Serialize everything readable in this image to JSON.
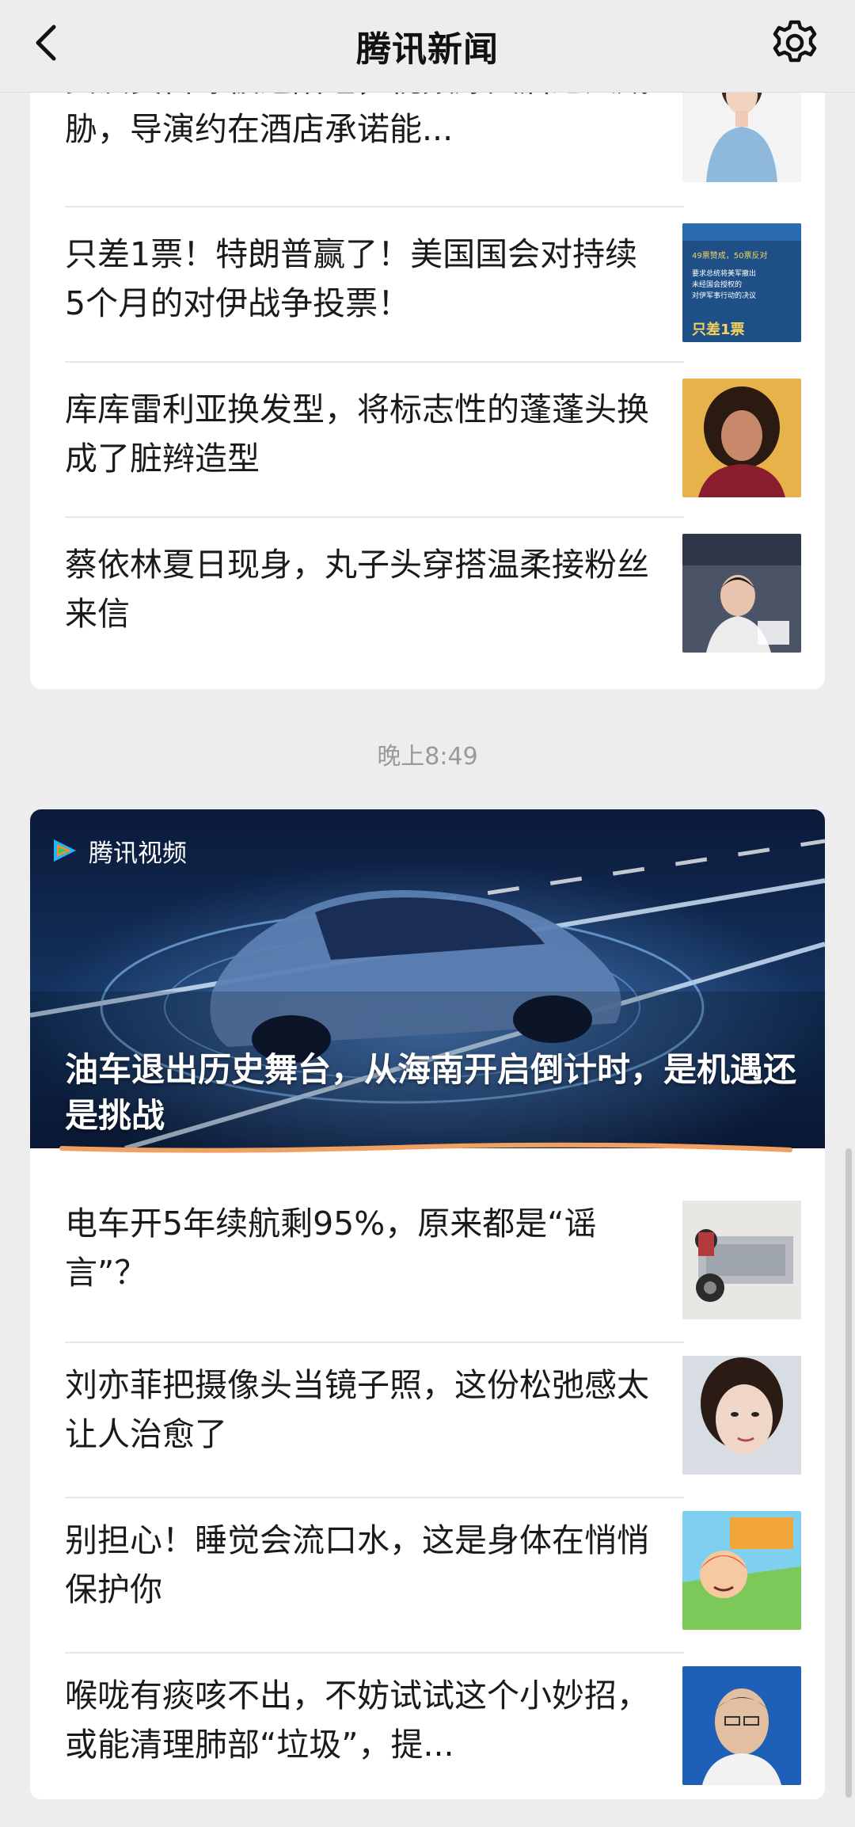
{
  "header": {
    "title": "腾讯新闻",
    "back_icon": "chevron-left-icon",
    "settings_icon": "gear-icon"
  },
  "card_top": {
    "items": [
      {
        "title": "女演员自曝被逼陪睡，视频爆火后遭人威胁，导演约在酒店承诺能..."
      },
      {
        "title": "只差1票！特朗普赢了！美国国会对持续5个月的对伊战争投票！",
        "thumb_text": [
          "49票赞成，50票反对",
          "要求总统将美军撤出",
          "未经国会授权的",
          "对伊军事行动的决议",
          "只差1票"
        ]
      },
      {
        "title": "库库雷利亚换发型，将标志性的蓬蓬头换成了脏辫造型"
      },
      {
        "title": "蔡依林夏日现身，丸子头穿搭温柔接粉丝来信"
      }
    ]
  },
  "timestamp": "晚上8:49",
  "card_bottom": {
    "hero": {
      "source": "腾讯视频",
      "title": "油车退出历史舞台，从海南开启倒计时，是机遇还是挑战"
    },
    "items": [
      {
        "title": "电车开5年续航剩95%，原来都是“谣言”？"
      },
      {
        "title": "刘亦菲把摄像头当镜子照，这份松弛感太让人治愈了"
      },
      {
        "title": "别担心！睡觉会流口水，这是身体在悄悄保护你"
      },
      {
        "title": "喉咙有痰咳不出，不妨试试这个小妙招，或能清理肺部“垃圾”，提..."
      }
    ]
  },
  "colors": {
    "background": "#ededed",
    "card": "#ffffff",
    "underline": "#f0a060",
    "timestamp": "#9a9a9a"
  }
}
